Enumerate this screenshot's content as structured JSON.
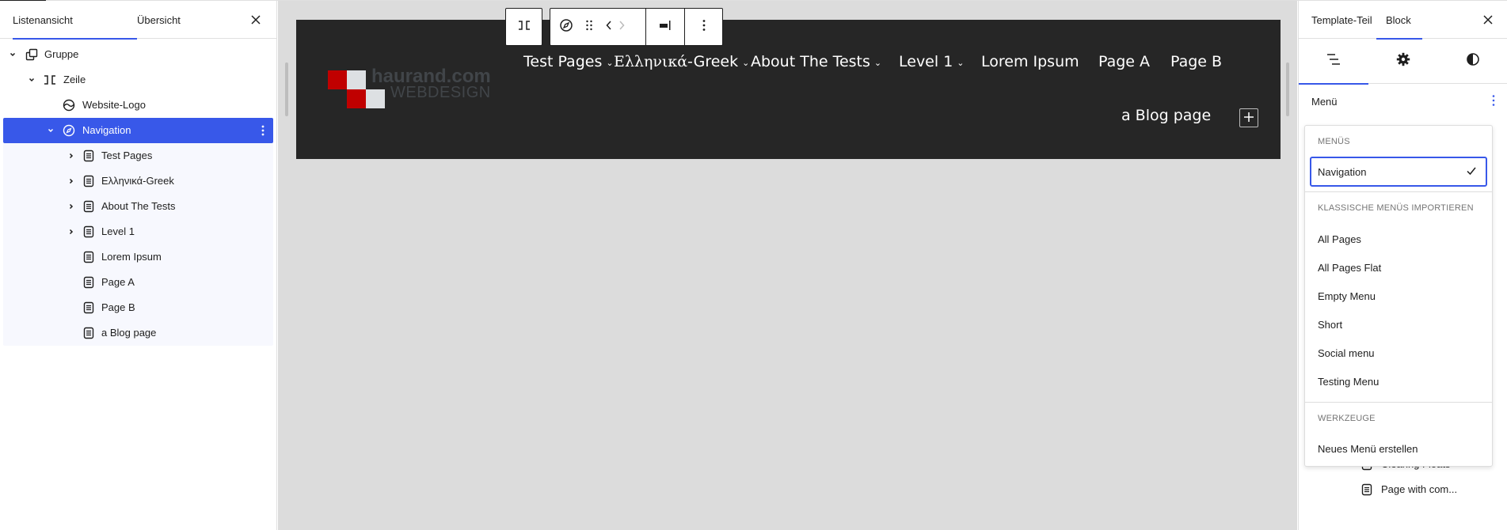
{
  "left_panel": {
    "tabs": [
      {
        "label": "Listenansicht",
        "active": true
      },
      {
        "label": "Übersicht",
        "active": false
      }
    ],
    "close_icon": "close-icon",
    "tree": [
      {
        "label": "Gruppe",
        "icon": "group-icon",
        "expanded": true,
        "level": 1
      },
      {
        "label": "Zeile",
        "icon": "row-icon",
        "expanded": true,
        "level": 2
      },
      {
        "label": "Website-Logo",
        "icon": "site-logo-icon",
        "level": 3
      },
      {
        "label": "Navigation",
        "icon": "navigation-icon",
        "expanded": true,
        "selected": true,
        "level": 3
      },
      {
        "label": "Test Pages",
        "icon": "page-icon",
        "has_children": true,
        "level": 4
      },
      {
        "label": "Ελληνικά-Greek",
        "icon": "page-icon",
        "has_children": true,
        "level": 4
      },
      {
        "label": "About The Tests",
        "icon": "page-icon",
        "has_children": true,
        "level": 4
      },
      {
        "label": "Level 1",
        "icon": "page-icon",
        "has_children": true,
        "level": 4
      },
      {
        "label": "Lorem Ipsum",
        "icon": "page-icon",
        "level": 4
      },
      {
        "label": "Page A",
        "icon": "page-icon",
        "level": 4
      },
      {
        "label": "Page B",
        "icon": "page-icon",
        "level": 4
      },
      {
        "label": "a Blog page",
        "icon": "page-icon",
        "level": 4
      }
    ]
  },
  "canvas": {
    "logo": {
      "line1": "haurand.com",
      "line2": "WEBDESIGN",
      "red": "#c00000",
      "light": "#dde0e3"
    },
    "header_bg": "#262626",
    "nav_items": [
      {
        "label": "Test Pages",
        "submenu": true
      },
      {
        "label": "Ελληνικά",
        "suffix": "-Greek",
        "submenu": true
      },
      {
        "label": "About The Tests",
        "submenu": true
      },
      {
        "label": "Level 1",
        "submenu": true
      },
      {
        "label": "Lorem Ipsum",
        "submenu": false
      },
      {
        "label": "Page A",
        "submenu": false
      },
      {
        "label": "Page B",
        "submenu": false
      },
      {
        "label": "a Blog page",
        "submenu": false
      }
    ],
    "add_block_icon": "plus-icon",
    "toolbar": {
      "buttons": [
        "parent-row-icon",
        "navigation-icon",
        "drag-handle-icon",
        "move-left-icon",
        "move-right-icon",
        "justify-right-icon",
        "more-options-icon"
      ]
    }
  },
  "right_panel": {
    "tabs": [
      {
        "label": "Template-Teil",
        "active": false
      },
      {
        "label": "Block",
        "active": true
      }
    ],
    "subtabs": [
      "list-view-icon",
      "settings-gear-icon",
      "styles-contrast-icon"
    ],
    "menu_label": "Menü",
    "list_items": [
      "Clearing Floats",
      "Page with com..."
    ]
  },
  "dropdown": {
    "section_menus": "Menüs",
    "selected": "Navigation",
    "section_classic": "Klassische Menüs importieren",
    "classic_items": [
      "All Pages",
      "All Pages Flat",
      "Empty Menu",
      "Short",
      "Social menu",
      "Testing Menu"
    ],
    "section_tools": "Werkzeuge",
    "tools_items": [
      "Neues Menü erstellen"
    ]
  },
  "colors": {
    "accent": "#3858e9",
    "canvas_bg": "#dcdcdc"
  }
}
